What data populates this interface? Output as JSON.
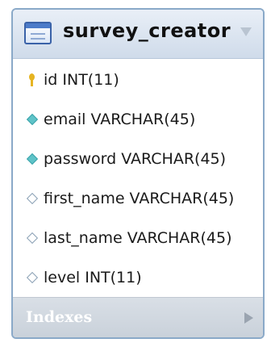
{
  "table": {
    "name": "survey_creator",
    "columns": [
      {
        "text": "id INT(11)",
        "icon": "primary-key-icon"
      },
      {
        "text": "email VARCHAR(45)",
        "icon": "not-null-column-icon"
      },
      {
        "text": "password VARCHAR(45)",
        "icon": "not-null-column-icon"
      },
      {
        "text": "first_name VARCHAR(45)",
        "icon": "nullable-column-icon"
      },
      {
        "text": "last_name VARCHAR(45)",
        "icon": "nullable-column-icon"
      },
      {
        "text": "level INT(11)",
        "icon": "nullable-column-icon"
      }
    ],
    "indexes_label": "Indexes"
  },
  "colors": {
    "header_bg": "#cfdbea",
    "border": "#8aa9c8",
    "key": "#e6b422",
    "not_null_diamond": "#5fc3c8",
    "indexes_bg": "#c9d1da"
  }
}
